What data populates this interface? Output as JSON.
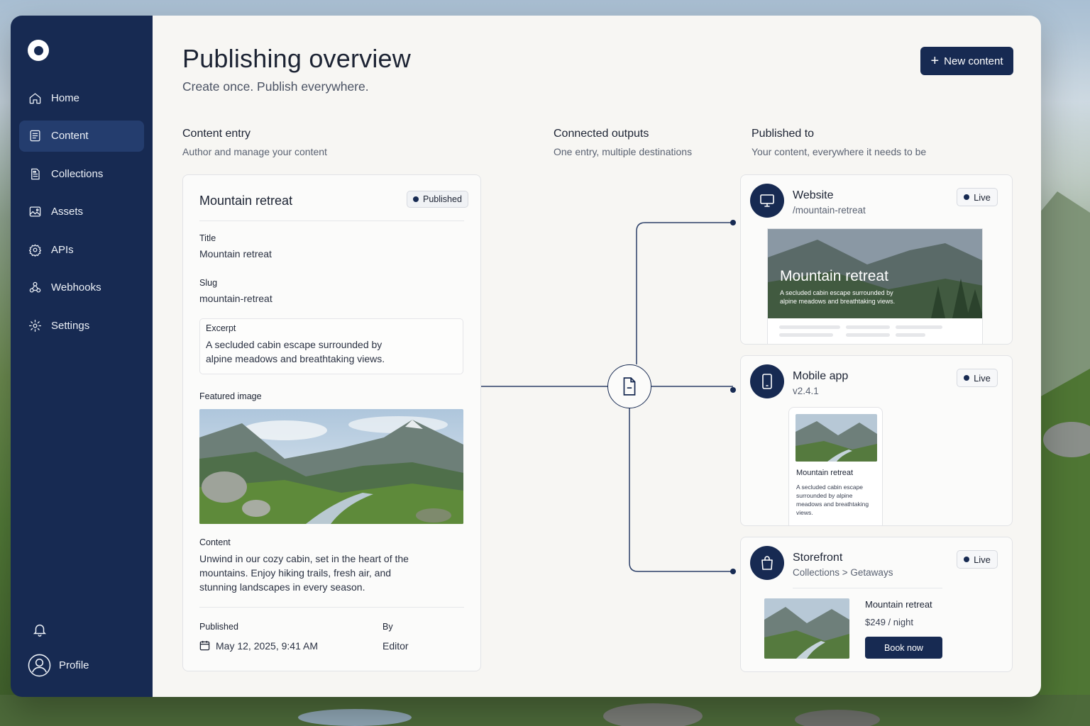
{
  "sidebar": {
    "items": [
      {
        "label": "Home",
        "icon": "home-icon"
      },
      {
        "label": "Content",
        "icon": "document-icon",
        "active": true
      },
      {
        "label": "Collections",
        "icon": "collections-icon"
      },
      {
        "label": "Assets",
        "icon": "image-icon"
      },
      {
        "label": "APIs",
        "icon": "api-icon"
      },
      {
        "label": "Webhooks",
        "icon": "webhook-icon"
      },
      {
        "label": "Settings",
        "icon": "gear-icon"
      }
    ],
    "profile_label": "Profile"
  },
  "header": {
    "title": "Publishing overview",
    "subtitle": "Create once. Publish everywhere.",
    "new_button": "New content"
  },
  "sections": {
    "entry": {
      "title": "Content entry",
      "subtitle": "Author and manage your content"
    },
    "outputs": {
      "title": "Connected outputs",
      "subtitle": "One entry, multiple destinations"
    },
    "published": {
      "title": "Published to",
      "subtitle": "Your content, everywhere it needs to be"
    }
  },
  "entry": {
    "name": "Mountain retreat",
    "status": "Published",
    "title_label": "Title",
    "title_value": "Mountain retreat",
    "slug_label": "Slug",
    "slug_value": "mountain-retreat",
    "excerpt_label": "Excerpt",
    "excerpt_value_1": "A secluded cabin escape surrounded by",
    "excerpt_value_2": "alpine meadows and breathtaking views.",
    "image_label": "Featured image",
    "content_label": "Content",
    "content_line_1": "Unwind in our cozy cabin, set in the heart of the",
    "content_line_2": "mountains. Enjoy hiking trails, fresh air, and",
    "content_line_3": "stunning landscapes in every season.",
    "published_label": "Published",
    "published_value": "May 12, 2025, 9:41 AM",
    "by_label": "By",
    "by_value": "Editor"
  },
  "outputs": {
    "website": {
      "name": "Website",
      "path": "/mountain-retreat",
      "status": "Live",
      "preview_title": "Mountain retreat",
      "preview_text": "A secluded cabin escape surrounded by alpine meadows and breathtaking views."
    },
    "mobile": {
      "name": "Mobile app",
      "version": "v2.4.1",
      "status": "Live",
      "preview_title": "Mountain retreat",
      "preview_text": "A secluded cabin escape surrounded by alpine meadows and breathtaking views."
    },
    "storefront": {
      "name": "Storefront",
      "path": "Collections > Getaways",
      "status": "Live",
      "product_title": "Mountain retreat",
      "price": "$249 / night",
      "button": "Book now"
    }
  },
  "colors": {
    "navy": "#172a52",
    "accent_active": "#243d6e",
    "panel": "#f7f6f3"
  }
}
